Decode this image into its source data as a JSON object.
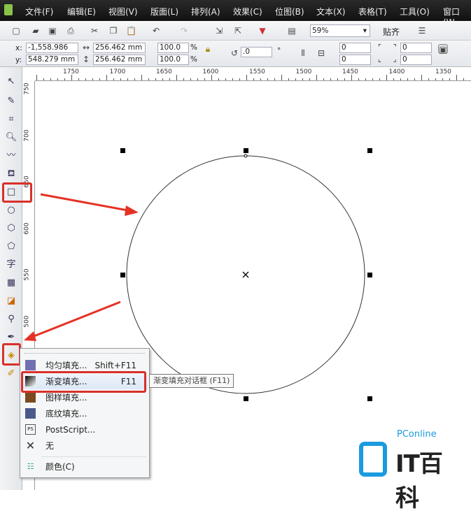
{
  "menubar": [
    "文件(F)",
    "编辑(E)",
    "视图(V)",
    "版面(L)",
    "排列(A)",
    "效果(C)",
    "位图(B)",
    "文本(X)",
    "表格(T)",
    "工具(O)",
    "窗口(W"
  ],
  "toolbar": {
    "zoom": "59%",
    "snap": "贴齐"
  },
  "propbar": {
    "x_label": "x:",
    "x": "-1,558.986 mm",
    "y_label": "y:",
    "y": "548.279 mm",
    "w": "256.462 mm",
    "h": "256.462 mm",
    "sx": "100.0",
    "sy": "100.0",
    "pct": "%",
    "angle": ".0",
    "deg": "°",
    "c1": "0",
    "c2": "0",
    "c3": "0",
    "c4": "0"
  },
  "hruler": [
    "1750",
    "1700",
    "1650",
    "1600",
    "1550",
    "1500",
    "1450",
    "1400",
    "1350"
  ],
  "vruler": [
    "750",
    "700",
    "650",
    "600",
    "550",
    "500"
  ],
  "menu": [
    {
      "label": "均匀填充...",
      "shortcut": "Shift+F11",
      "icon": "uniform-fill-icon"
    },
    {
      "label": "渐变填充...",
      "shortcut": "F11",
      "icon": "fountain-fill-icon"
    },
    {
      "label": "图样填充...",
      "shortcut": "",
      "icon": "pattern-fill-icon"
    },
    {
      "label": "底纹填充...",
      "shortcut": "",
      "icon": "texture-fill-icon"
    },
    {
      "label": "PostScript...",
      "shortcut": "",
      "icon": "postscript-icon"
    },
    {
      "label": "无",
      "shortcut": "",
      "icon": "none-x-icon"
    },
    {
      "label": "颜色(C)",
      "shortcut": "",
      "icon": "color-icon"
    }
  ],
  "tooltip": "渐变填充对话框 (F11)",
  "watermark": {
    "brand": "PConline",
    "text": "IT百科"
  },
  "colors": {
    "highlight": "#d9302a"
  }
}
